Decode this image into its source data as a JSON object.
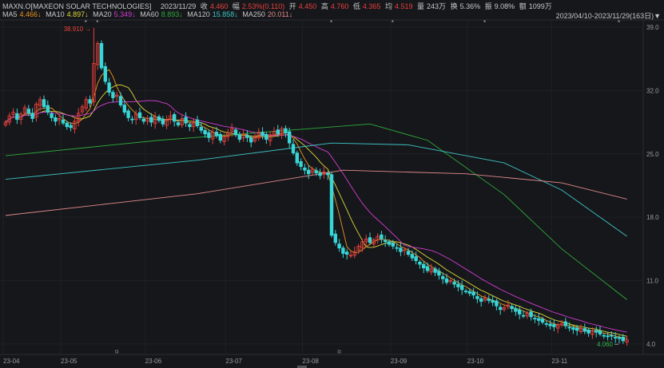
{
  "header": {
    "symbol": "MAXN.O[MAXEON SOLAR TECHNOLOGIES]",
    "date": "2023/11/29",
    "close_label": "收",
    "close": "4.460",
    "change_label": "幅",
    "change": "2.53%(0.110)",
    "open_label": "开",
    "open": "4.450",
    "high_label": "高",
    "high": "4.760",
    "low_label": "低",
    "low": "4.365",
    "avg_label": "均",
    "avg": "4.519",
    "volume_label": "量",
    "volume": "243万",
    "turnover_label": "换",
    "turnover": "5.36%",
    "amplitude_label": "振",
    "amplitude": "9.08%",
    "amount_label": "额",
    "amount": "1099万",
    "range": "2023/04/10-2023/11/29(163日)▼"
  },
  "ma": [
    {
      "label": "MA5",
      "value": "4.466↓",
      "color": "#e8961e"
    },
    {
      "label": "MA10",
      "value": "4.897↓",
      "color": "#e0d83a"
    },
    {
      "label": "MA20",
      "value": "5.349↓",
      "color": "#d23cd2"
    },
    {
      "label": "MA60",
      "value": "8.893↓",
      "color": "#2eaa3a"
    },
    {
      "label": "MA120",
      "value": "15.858↓",
      "color": "#3cc4c4"
    },
    {
      "label": "MA250",
      "value": "20.011↓",
      "color": "#e08a8a"
    }
  ],
  "chart_data": {
    "type": "candlestick",
    "ylim": [
      4.0,
      39.0
    ],
    "y_ticks": [
      "39.0",
      "32.0",
      "25.0",
      "18.0",
      "11.0",
      "4.0"
    ],
    "y_tick_values": [
      39,
      32,
      25,
      18,
      11,
      4
    ],
    "x_ticks": [
      {
        "label": "23-04",
        "index": 0
      },
      {
        "label": "23-05",
        "index": 15
      },
      {
        "label": "23-06",
        "index": 37
      },
      {
        "label": "23-07",
        "index": 58
      },
      {
        "label": "23-08",
        "index": 78
      },
      {
        "label": "23-09",
        "index": 101
      },
      {
        "label": "23-10",
        "index": 121
      },
      {
        "label": "23-11",
        "index": 143
      }
    ],
    "closes": [
      28.5,
      29.2,
      29.6,
      28.8,
      29.4,
      30.1,
      29.5,
      28.9,
      30.5,
      31.0,
      30.2,
      29.6,
      29.0,
      28.6,
      28.9,
      28.4,
      28.0,
      27.9,
      28.6,
      29.5,
      30.2,
      31.0,
      30.6,
      35.0,
      37.2,
      34.5,
      33.0,
      31.8,
      31.2,
      31.5,
      30.4,
      29.6,
      29.0,
      28.8,
      29.4,
      29.0,
      28.6,
      28.9,
      28.5,
      29.1,
      28.7,
      28.3,
      28.8,
      29.2,
      28.6,
      28.2,
      28.9,
      28.4,
      28.0,
      28.6,
      28.1,
      27.6,
      27.2,
      26.8,
      27.4,
      27.0,
      26.5,
      26.9,
      27.3,
      27.8,
      27.1,
      26.6,
      27.2,
      26.8,
      26.3,
      26.9,
      27.4,
      27.0,
      26.6,
      27.1,
      27.5,
      27.2,
      27.8,
      27.3,
      26.2,
      25.1,
      24.0,
      23.6,
      23.2,
      22.8,
      23.3,
      22.9,
      22.6,
      23.0,
      22.7,
      16.0,
      15.2,
      14.6,
      14.0,
      13.9,
      13.8,
      14.2,
      14.8,
      15.3,
      15.6,
      15.2,
      15.5,
      15.9,
      15.6,
      15.3,
      15.0,
      14.8,
      14.6,
      14.2,
      14.4,
      13.9,
      13.5,
      13.2,
      12.8,
      12.4,
      12.1,
      12.3,
      11.9,
      11.6,
      11.2,
      10.8,
      11.0,
      10.6,
      10.3,
      10.0,
      9.8,
      9.6,
      9.4,
      9.0,
      8.7,
      9.1,
      8.8,
      8.6,
      8.2,
      7.8,
      8.0,
      8.3,
      7.9,
      7.6,
      7.3,
      7.1,
      7.4,
      7.0,
      6.8,
      6.6,
      6.4,
      6.2,
      6.0,
      5.9,
      6.1,
      6.3,
      6.0,
      5.8,
      5.6,
      5.5,
      5.7,
      5.4,
      5.2,
      5.5,
      5.3,
      5.1,
      4.9,
      4.8,
      4.9,
      4.7,
      4.6,
      4.35,
      4.46
    ],
    "max_mark": {
      "index": 23,
      "value": 38.91,
      "label": "38.910"
    },
    "min_mark": {
      "index": 160,
      "value": 4.06,
      "label": "4.060"
    },
    "ma60_line": [
      [
        0,
        24.8
      ],
      [
        40,
        26.5
      ],
      [
        95,
        28.3
      ],
      [
        110,
        26.5
      ],
      [
        130,
        20.5
      ],
      [
        145,
        14.5
      ],
      [
        162,
        8.9
      ]
    ],
    "ma120_line": [
      [
        0,
        22.2
      ],
      [
        50,
        24.3
      ],
      [
        85,
        26.2
      ],
      [
        105,
        26.0
      ],
      [
        130,
        24.0
      ],
      [
        145,
        21.0
      ],
      [
        162,
        15.9
      ]
    ],
    "ma250_line": [
      [
        0,
        18.2
      ],
      [
        50,
        20.6
      ],
      [
        88,
        23.2
      ],
      [
        120,
        22.8
      ],
      [
        145,
        21.8
      ],
      [
        162,
        20.0
      ]
    ],
    "star_indices": [
      21,
      24,
      85,
      101,
      125,
      160
    ],
    "flag_indices": [
      29,
      87
    ],
    "up_color": "#e8403a",
    "down_color": "#38d6d6"
  }
}
